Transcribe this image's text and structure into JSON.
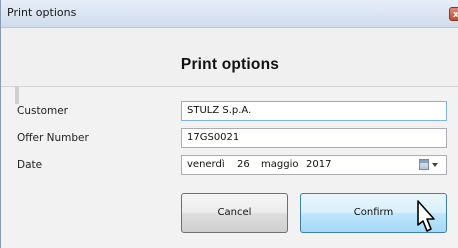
{
  "window": {
    "title": "Print options",
    "close_glyph": "x"
  },
  "header": {
    "title": "Print options"
  },
  "form": {
    "customer_label": "Customer",
    "customer_value": "STULZ S.p.A.",
    "offer_label": "Offer Number",
    "offer_value": "17GS0021",
    "date_label": "Date",
    "date_weekday": "venerdì",
    "date_day": "26",
    "date_month": "maggio",
    "date_year": "2017"
  },
  "buttons": {
    "cancel": "Cancel",
    "confirm": "Confirm"
  },
  "icons": {
    "calendar": "calendar-icon",
    "dropdown": "chevron-down-icon",
    "cursor": "mouse-pointer-icon"
  }
}
